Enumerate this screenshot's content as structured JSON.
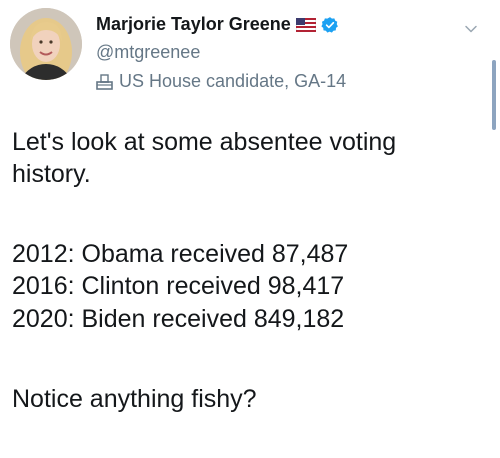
{
  "author": {
    "display_name": "Marjorie Taylor Greene",
    "handle": "@mtgreenee",
    "label": "US House candidate, GA-14",
    "flag_icon": "us-flag-icon",
    "verified_icon": "verified-badge-icon",
    "label_icon": "ballot-box-icon"
  },
  "tweet": {
    "lines": [
      "Let's look at some absentee voting",
      "history.",
      "2012: Obama received 87,487",
      "2016: Clinton received 98,417",
      "2020: Biden received 849,182",
      "Notice anything fishy?"
    ]
  },
  "colors": {
    "text": "#14171a",
    "secondary": "#657786",
    "verified": "#1da1f2"
  },
  "menu_icon": "chevron-down-icon"
}
